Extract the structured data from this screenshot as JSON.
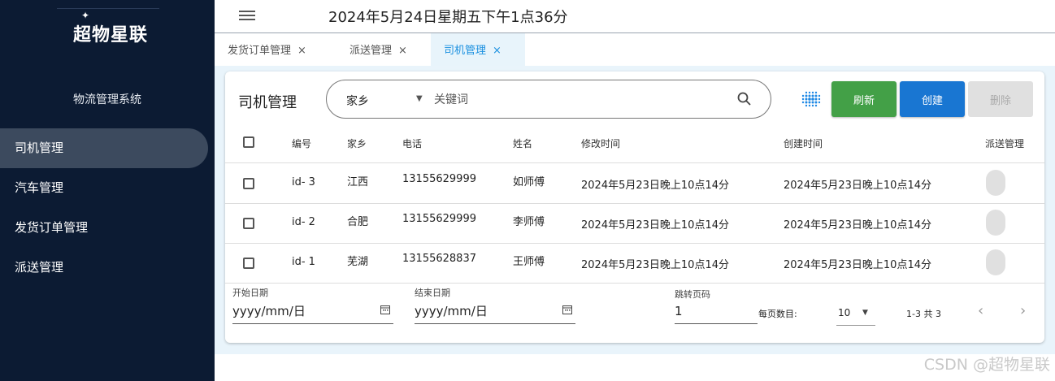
{
  "sidebar": {
    "logo": "超物星联",
    "system_title": "物流管理系统",
    "items": [
      {
        "label": "司机管理",
        "active": true
      },
      {
        "label": "汽车管理",
        "active": false
      },
      {
        "label": "发货订单管理",
        "active": false
      },
      {
        "label": "派送管理",
        "active": false
      }
    ]
  },
  "header": {
    "datetime": "2024年5月24日星期五下午1点36分",
    "menu_icon": "hamburger-menu-icon"
  },
  "tabs": [
    {
      "label": "发货订单管理",
      "active": false
    },
    {
      "label": "派送管理",
      "active": false
    },
    {
      "label": "司机管理",
      "active": true
    }
  ],
  "tab_close_glyph": "×",
  "card": {
    "title": "司机管理",
    "search": {
      "selected_field": "家乡",
      "placeholder": "关键词",
      "value": ""
    },
    "buttons": {
      "refresh": "刷新",
      "create": "创建",
      "delete": "删除"
    },
    "columns": [
      "编号",
      "家乡",
      "电话",
      "姓名",
      "修改时间",
      "创建时间",
      "派送管理"
    ],
    "rows": [
      {
        "id": "id- 3",
        "hometown": "江西",
        "phone": "13155629999",
        "name": "如师傅",
        "modified": "2024年5月23日晚上10点14分",
        "created": "2024年5月23日晚上10点14分"
      },
      {
        "id": "id- 2",
        "hometown": "合肥",
        "phone": "13155629999",
        "name": "李师傅",
        "modified": "2024年5月23日晚上10点14分",
        "created": "2024年5月23日晚上10点14分"
      },
      {
        "id": "id- 1",
        "hometown": "芜湖",
        "phone": "13155628837",
        "name": "王师傅",
        "modified": "2024年5月23日晚上10点14分",
        "created": "2024年5月23日晚上10点14分"
      }
    ],
    "footer": {
      "start_date_label": "开始日期",
      "start_date_value": "yyyy/mm/日",
      "end_date_label": "结束日期",
      "end_date_value": "yyyy/mm/日",
      "jump_label": "跳转页码",
      "jump_value": "1",
      "per_page_label": "每页数目:",
      "per_page_value": "10",
      "range_text": "1-3 共 3",
      "prev_glyph": "‹",
      "next_glyph": "›"
    }
  },
  "watermark": "CSDN @超物星联",
  "colors": {
    "sidebar_bg": "#0c1b33",
    "nav_active_bg": "#3c4a5e",
    "accent_blue": "#1976d2",
    "refresh_green": "#43a047",
    "tab_active_text": "#1a90e0"
  }
}
